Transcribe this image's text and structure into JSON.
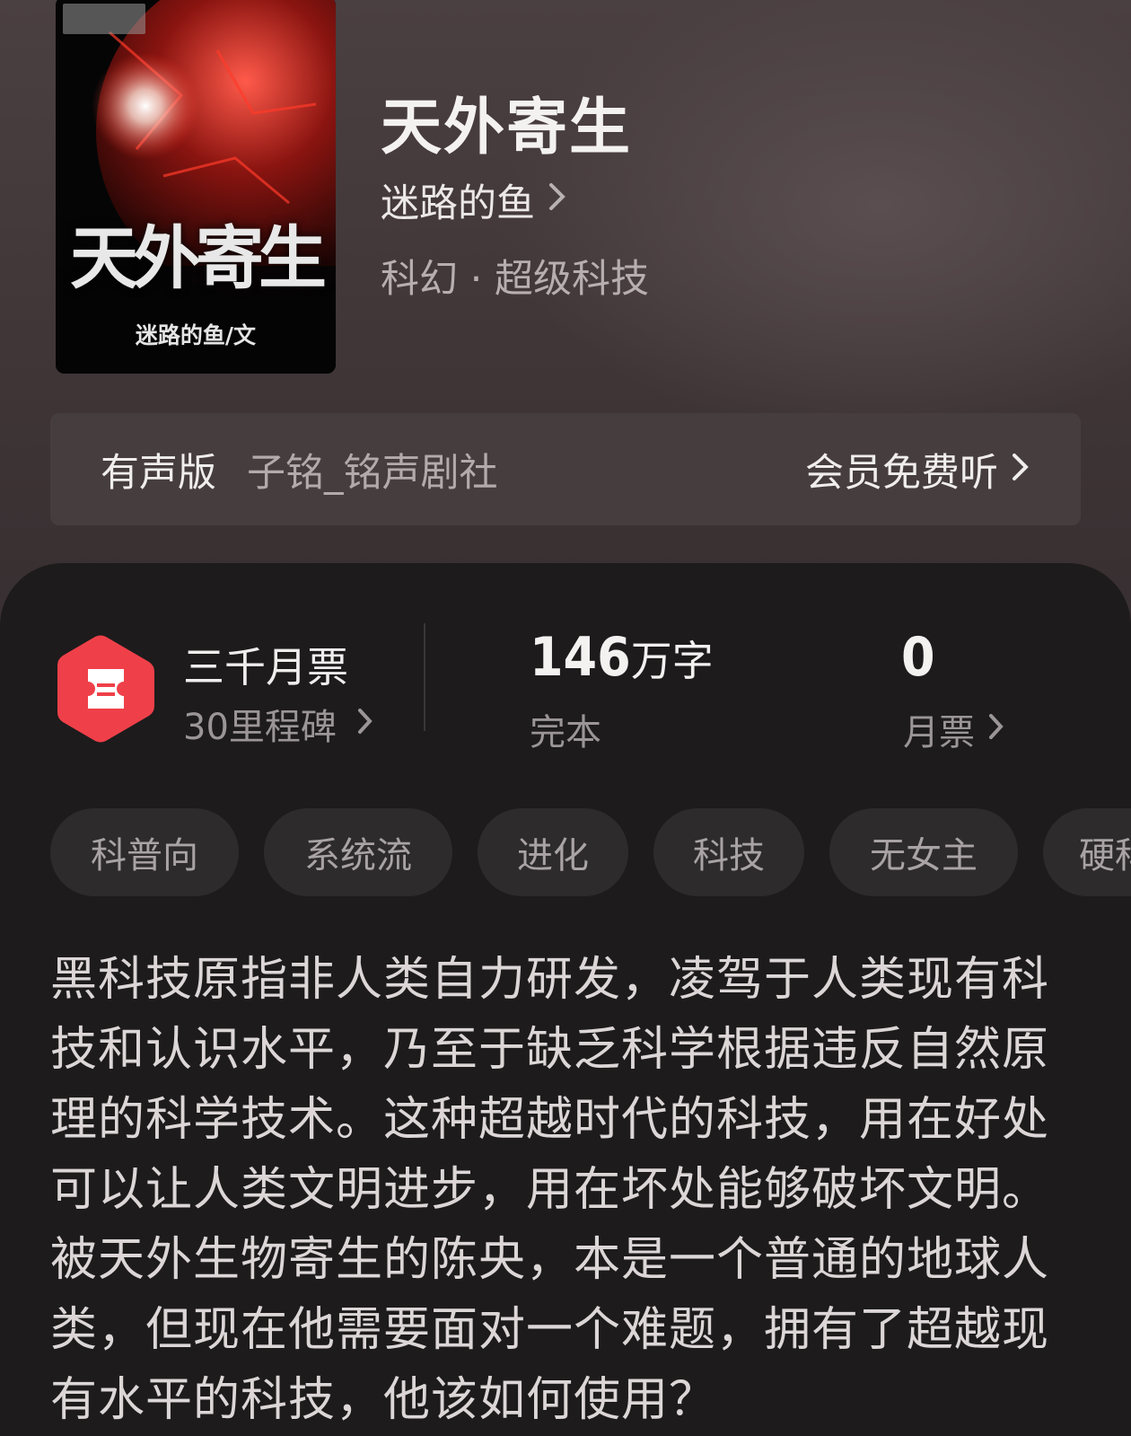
{
  "book": {
    "cover_title": "天外寄生",
    "cover_author": "迷路的鱼/文",
    "title": "天外寄生",
    "author": "迷路的鱼",
    "genre": "科幻 · 超级科技"
  },
  "audio": {
    "label": "有声版",
    "narrator": "子铭_铭声剧社",
    "cta": "会员免费听"
  },
  "stats": {
    "ranking_title": "三千月票",
    "ranking_sub": "30里程碑",
    "word_count_number": "146",
    "word_count_unit": "万字",
    "status": "完本",
    "votes_number": "0",
    "votes_label": "月票"
  },
  "tags": [
    "科普向",
    "系统流",
    "进化",
    "科技",
    "无女主",
    "硬科"
  ],
  "description": "黑科技原指非人类自力研发，凌驾于人类现有科技和认识水平，乃至于缺乏科学根据违反自然原理的科学技术。这种超越时代的科技，用在好处可以让人类文明进步，用在坏处能够破坏文明。被天外生物寄生的陈央，本是一个普通的地球人类，但现在他需要面对一个难题，拥有了超越现有水平的科技，他该如何使用？",
  "colors": {
    "header_bg": "#3f3537",
    "panel_bg": "#1d1b1c",
    "badge_red": "#ef4049",
    "tag_bg": "#2e2b2c"
  },
  "icons": {
    "chevron": "chevron-right-icon",
    "badge": "ticket-badge-icon"
  }
}
